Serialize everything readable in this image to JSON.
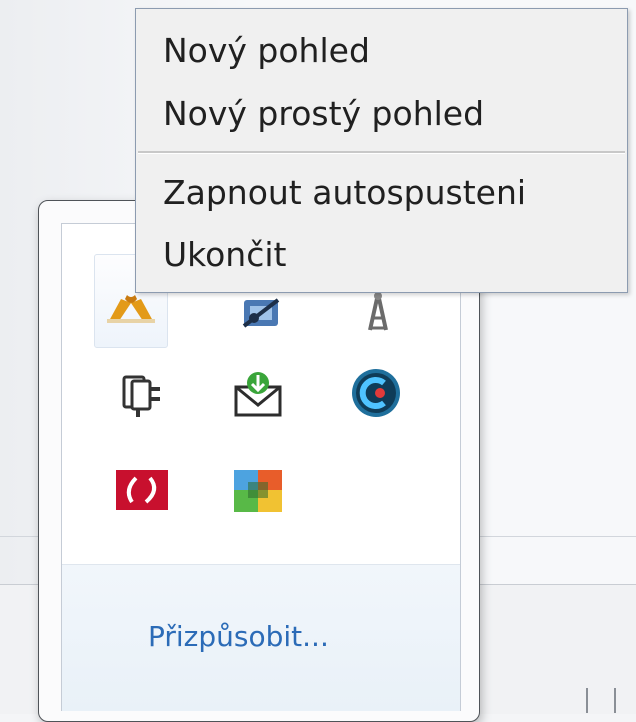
{
  "context_menu": {
    "items": [
      {
        "label": "Nový pohled"
      },
      {
        "label": "Nový prostý pohled"
      },
      {
        "label": "Zapnout autospusteni"
      },
      {
        "label": "Ukončit"
      }
    ]
  },
  "tray_popup": {
    "customize_label": "Přizpůsobit...",
    "icons": [
      {
        "name": "java-icon"
      },
      {
        "name": "network-icon"
      },
      {
        "name": "wireless-tower-icon"
      },
      {
        "name": "power-plug-icon"
      },
      {
        "name": "mail-download-icon"
      },
      {
        "name": "capture-app-icon"
      },
      {
        "name": "red-app-icon"
      },
      {
        "name": "avg-icon"
      }
    ]
  },
  "colors": {
    "link": "#2b6bb7",
    "menu_bg": "#f0f0f0",
    "menu_border": "#8c9bb0"
  }
}
